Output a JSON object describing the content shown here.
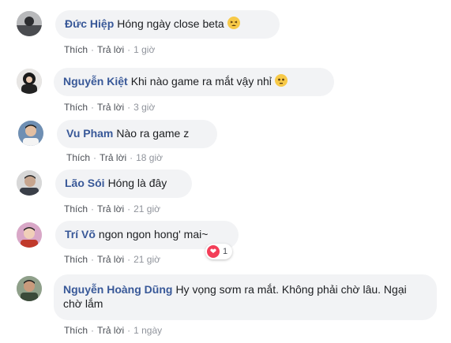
{
  "comments": [
    {
      "name": "Đức Hiệp",
      "text": "Hóng ngày close beta",
      "emoji": "tired-face-emoji",
      "like": "Thích",
      "reply": "Trả lời",
      "time": "1 giờ"
    },
    {
      "name": "Nguyễn Kiệt",
      "text": "Khi nào game ra mắt vậy nhỉ",
      "emoji": "flushed-face-emoji",
      "like": "Thích",
      "reply": "Trả lời",
      "time": "3 giờ"
    },
    {
      "name": "Vu Pham",
      "text": "Nào ra game z",
      "like": "Thích",
      "reply": "Trả lời",
      "time": "18 giờ"
    },
    {
      "name": "Lão Sói",
      "text": "Hóng là đây",
      "like": "Thích",
      "reply": "Trả lời",
      "time": "21 giờ"
    },
    {
      "name": "Trí Võ",
      "text": "ngon ngon hong' mai~",
      "like": "Thích",
      "reply": "Trả lời",
      "time": "21 giờ",
      "reaction": {
        "icon": "heart-reaction-icon",
        "count": "1"
      }
    },
    {
      "name": "Nguyễn Hoàng Dũng",
      "text": "Hy vọng sơm ra mắt. Không phải chờ lâu. Ngại chờ lắm",
      "like": "Thích",
      "reply": "Trả lời",
      "time": "1 ngày"
    }
  ],
  "separator": "·",
  "colors": {
    "name": "#385898",
    "bubble": "#f2f3f5",
    "meta": "#90949c",
    "heart": "#f33e58"
  }
}
